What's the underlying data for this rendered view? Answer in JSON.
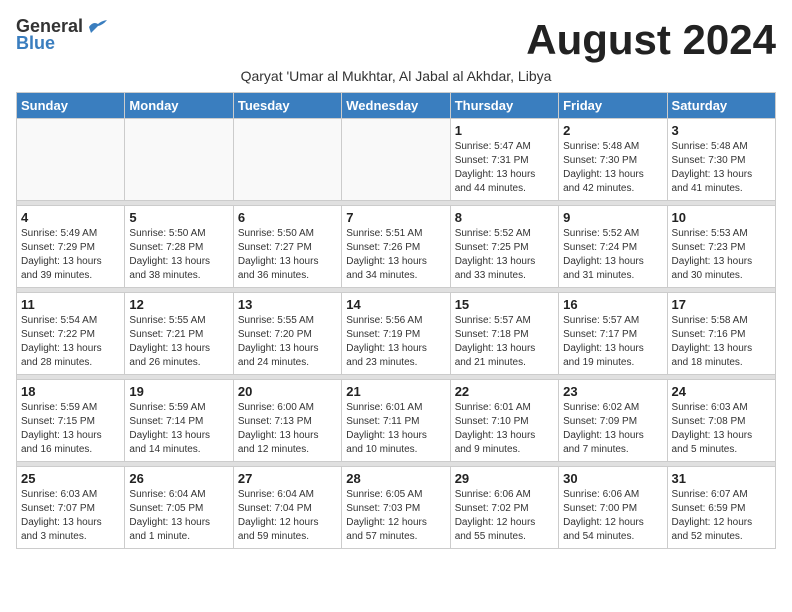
{
  "header": {
    "logo_general": "General",
    "logo_blue": "Blue",
    "month_title": "August 2024",
    "subtitle": "Qaryat 'Umar al Mukhtar, Al Jabal al Akhdar, Libya"
  },
  "weekdays": [
    "Sunday",
    "Monday",
    "Tuesday",
    "Wednesday",
    "Thursday",
    "Friday",
    "Saturday"
  ],
  "weeks": [
    {
      "days": [
        {
          "num": "",
          "info": ""
        },
        {
          "num": "",
          "info": ""
        },
        {
          "num": "",
          "info": ""
        },
        {
          "num": "",
          "info": ""
        },
        {
          "num": "1",
          "info": "Sunrise: 5:47 AM\nSunset: 7:31 PM\nDaylight: 13 hours\nand 44 minutes."
        },
        {
          "num": "2",
          "info": "Sunrise: 5:48 AM\nSunset: 7:30 PM\nDaylight: 13 hours\nand 42 minutes."
        },
        {
          "num": "3",
          "info": "Sunrise: 5:48 AM\nSunset: 7:30 PM\nDaylight: 13 hours\nand 41 minutes."
        }
      ]
    },
    {
      "days": [
        {
          "num": "4",
          "info": "Sunrise: 5:49 AM\nSunset: 7:29 PM\nDaylight: 13 hours\nand 39 minutes."
        },
        {
          "num": "5",
          "info": "Sunrise: 5:50 AM\nSunset: 7:28 PM\nDaylight: 13 hours\nand 38 minutes."
        },
        {
          "num": "6",
          "info": "Sunrise: 5:50 AM\nSunset: 7:27 PM\nDaylight: 13 hours\nand 36 minutes."
        },
        {
          "num": "7",
          "info": "Sunrise: 5:51 AM\nSunset: 7:26 PM\nDaylight: 13 hours\nand 34 minutes."
        },
        {
          "num": "8",
          "info": "Sunrise: 5:52 AM\nSunset: 7:25 PM\nDaylight: 13 hours\nand 33 minutes."
        },
        {
          "num": "9",
          "info": "Sunrise: 5:52 AM\nSunset: 7:24 PM\nDaylight: 13 hours\nand 31 minutes."
        },
        {
          "num": "10",
          "info": "Sunrise: 5:53 AM\nSunset: 7:23 PM\nDaylight: 13 hours\nand 30 minutes."
        }
      ]
    },
    {
      "days": [
        {
          "num": "11",
          "info": "Sunrise: 5:54 AM\nSunset: 7:22 PM\nDaylight: 13 hours\nand 28 minutes."
        },
        {
          "num": "12",
          "info": "Sunrise: 5:55 AM\nSunset: 7:21 PM\nDaylight: 13 hours\nand 26 minutes."
        },
        {
          "num": "13",
          "info": "Sunrise: 5:55 AM\nSunset: 7:20 PM\nDaylight: 13 hours\nand 24 minutes."
        },
        {
          "num": "14",
          "info": "Sunrise: 5:56 AM\nSunset: 7:19 PM\nDaylight: 13 hours\nand 23 minutes."
        },
        {
          "num": "15",
          "info": "Sunrise: 5:57 AM\nSunset: 7:18 PM\nDaylight: 13 hours\nand 21 minutes."
        },
        {
          "num": "16",
          "info": "Sunrise: 5:57 AM\nSunset: 7:17 PM\nDaylight: 13 hours\nand 19 minutes."
        },
        {
          "num": "17",
          "info": "Sunrise: 5:58 AM\nSunset: 7:16 PM\nDaylight: 13 hours\nand 18 minutes."
        }
      ]
    },
    {
      "days": [
        {
          "num": "18",
          "info": "Sunrise: 5:59 AM\nSunset: 7:15 PM\nDaylight: 13 hours\nand 16 minutes."
        },
        {
          "num": "19",
          "info": "Sunrise: 5:59 AM\nSunset: 7:14 PM\nDaylight: 13 hours\nand 14 minutes."
        },
        {
          "num": "20",
          "info": "Sunrise: 6:00 AM\nSunset: 7:13 PM\nDaylight: 13 hours\nand 12 minutes."
        },
        {
          "num": "21",
          "info": "Sunrise: 6:01 AM\nSunset: 7:11 PM\nDaylight: 13 hours\nand 10 minutes."
        },
        {
          "num": "22",
          "info": "Sunrise: 6:01 AM\nSunset: 7:10 PM\nDaylight: 13 hours\nand 9 minutes."
        },
        {
          "num": "23",
          "info": "Sunrise: 6:02 AM\nSunset: 7:09 PM\nDaylight: 13 hours\nand 7 minutes."
        },
        {
          "num": "24",
          "info": "Sunrise: 6:03 AM\nSunset: 7:08 PM\nDaylight: 13 hours\nand 5 minutes."
        }
      ]
    },
    {
      "days": [
        {
          "num": "25",
          "info": "Sunrise: 6:03 AM\nSunset: 7:07 PM\nDaylight: 13 hours\nand 3 minutes."
        },
        {
          "num": "26",
          "info": "Sunrise: 6:04 AM\nSunset: 7:05 PM\nDaylight: 13 hours\nand 1 minute."
        },
        {
          "num": "27",
          "info": "Sunrise: 6:04 AM\nSunset: 7:04 PM\nDaylight: 12 hours\nand 59 minutes."
        },
        {
          "num": "28",
          "info": "Sunrise: 6:05 AM\nSunset: 7:03 PM\nDaylight: 12 hours\nand 57 minutes."
        },
        {
          "num": "29",
          "info": "Sunrise: 6:06 AM\nSunset: 7:02 PM\nDaylight: 12 hours\nand 55 minutes."
        },
        {
          "num": "30",
          "info": "Sunrise: 6:06 AM\nSunset: 7:00 PM\nDaylight: 12 hours\nand 54 minutes."
        },
        {
          "num": "31",
          "info": "Sunrise: 6:07 AM\nSunset: 6:59 PM\nDaylight: 12 hours\nand 52 minutes."
        }
      ]
    }
  ]
}
